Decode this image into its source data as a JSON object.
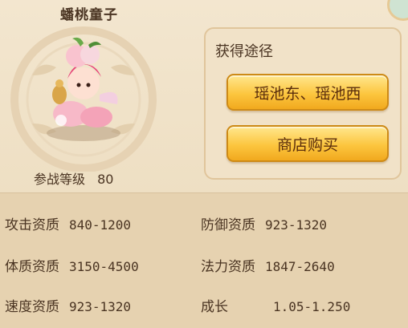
{
  "pet": {
    "name": "蟠桃童子",
    "level_label": "参战等级",
    "level_value": "80"
  },
  "obtain": {
    "title": "获得途径",
    "buttons": [
      "瑶池东、瑶池西",
      "商店购买"
    ]
  },
  "stats": [
    {
      "label": "攻击资质",
      "value": "840-1200"
    },
    {
      "label": "防御资质",
      "value": "923-1320"
    },
    {
      "label": "体质资质",
      "value": "3150-4500"
    },
    {
      "label": "法力资质",
      "value": "1847-2640"
    },
    {
      "label": "速度资质",
      "value": "923-1320"
    },
    {
      "label": "成长",
      "value": "1.05-1.250"
    }
  ],
  "colors": {
    "panel_top": "#f3e6cf",
    "panel_bottom": "#e6d2b0",
    "button_gold": "#fcc63f",
    "text": "#4a3422"
  }
}
